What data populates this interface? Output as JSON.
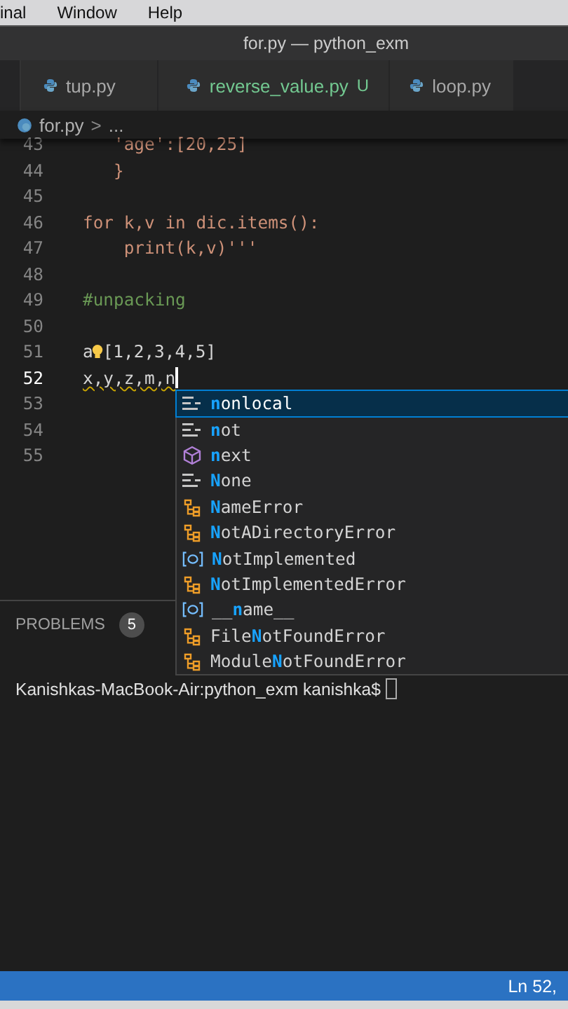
{
  "menu_bar": [
    "inal",
    "Window",
    "Help"
  ],
  "window": {
    "title": "for.py — python_exm"
  },
  "tabs": [
    {
      "label": "tup.py",
      "selected": false
    },
    {
      "label": "reverse_value.py",
      "status": "U",
      "selected": false
    },
    {
      "label": "loop.py",
      "selected": false
    }
  ],
  "breadcrumb": {
    "file": "for.py",
    "separator": ">",
    "rest": "..."
  },
  "editor": {
    "lines": [
      {
        "number": "43",
        "current": false,
        "segments": [
          {
            "kind": "string",
            "text": "   'age':[20,25]"
          }
        ]
      },
      {
        "number": "44",
        "current": false,
        "segments": [
          {
            "kind": "string",
            "text": "   }"
          }
        ]
      },
      {
        "number": "45",
        "current": false
      },
      {
        "number": "46",
        "current": false,
        "segments": [
          {
            "kind": "string",
            "text": "for k,v in dic.items():"
          }
        ]
      },
      {
        "number": "47",
        "current": false,
        "segments": [
          {
            "kind": "string",
            "text": "    print(k,v)'''"
          }
        ]
      },
      {
        "number": "48",
        "current": false
      },
      {
        "number": "49",
        "current": false,
        "segments": [
          {
            "kind": "comment",
            "text": "#unpacking"
          }
        ]
      },
      {
        "number": "50",
        "current": false
      },
      {
        "number": "51",
        "current": false,
        "segments": [
          {
            "kind": "plain",
            "text": "a"
          },
          {
            "kind": "bulb"
          },
          {
            "kind": "plain",
            "text": "[1,2,3,4,5]"
          }
        ]
      },
      {
        "number": "52",
        "current": true,
        "segments": [
          {
            "kind": "squiggle",
            "text": "x,y,z,m,n"
          },
          {
            "kind": "cursor"
          }
        ]
      },
      {
        "number": "53",
        "current": false
      },
      {
        "number": "54",
        "current": false
      },
      {
        "number": "55",
        "current": false
      }
    ]
  },
  "suggestions": [
    {
      "kind": "keyword",
      "match": "n",
      "after": "onlocal",
      "selected": true
    },
    {
      "kind": "keyword",
      "match": "n",
      "after": "ot",
      "selected": false
    },
    {
      "kind": "function",
      "match": "n",
      "after": "ext",
      "selected": false
    },
    {
      "kind": "keyword",
      "match": "N",
      "after": "one",
      "selected": false
    },
    {
      "kind": "class",
      "match": "N",
      "after": "ameError",
      "selected": false
    },
    {
      "kind": "class",
      "match": "N",
      "after": "otADirectoryError",
      "selected": false
    },
    {
      "kind": "variable",
      "match": "N",
      "after": "otImplemented",
      "selected": false
    },
    {
      "kind": "class",
      "match": "N",
      "after": "otImplementedError",
      "selected": false
    },
    {
      "kind": "variable",
      "before": "__",
      "match": "n",
      "after": "ame__",
      "selected": false
    },
    {
      "kind": "class",
      "before": "File",
      "match": "N",
      "after": "otFoundError",
      "selected": false
    },
    {
      "kind": "class",
      "before": "Module",
      "match": "N",
      "after": "otFoundError",
      "selected": false
    }
  ],
  "panel": {
    "tab": "PROBLEMS",
    "count": "5",
    "terminal": "Kanishkas-MacBook-Air:python_exm kanishka$"
  },
  "status_bar": {
    "position": "Ln 52,"
  }
}
